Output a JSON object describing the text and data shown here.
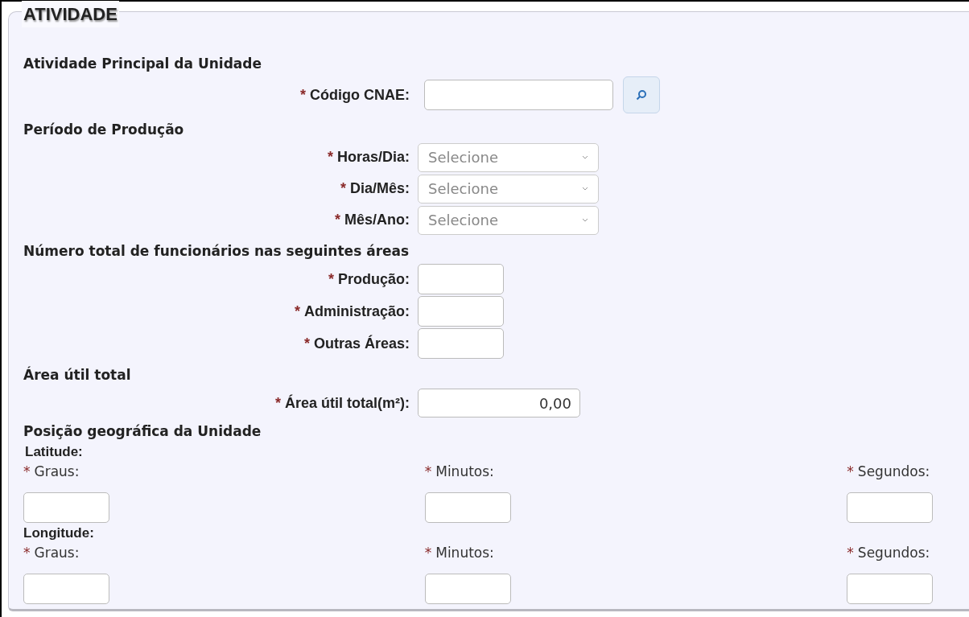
{
  "legend": "ATIVIDADE",
  "sections": [
    {
      "heading": "Atividade Principal da Unidade",
      "fields": [
        {
          "kind": "search",
          "label": "Código CNAE:",
          "required_mark": "*"
        }
      ]
    },
    {
      "heading": "Período de Produção",
      "fields": [
        {
          "kind": "select",
          "label": "Horas/Dia:",
          "required_mark": "*",
          "placeholder": "Selecione"
        },
        {
          "kind": "select",
          "label": "Dia/Mês:",
          "required_mark": "*",
          "placeholder": "Selecione"
        },
        {
          "kind": "select",
          "label": "Mês/Ano:",
          "required_mark": "*",
          "placeholder": "Selecione"
        }
      ]
    },
    {
      "heading": "Número total de funcionários nas seguintes áreas",
      "fields": [
        {
          "kind": "small",
          "label": "Produção:",
          "required_mark": "*"
        },
        {
          "kind": "small",
          "label": "Administração:",
          "required_mark": "*"
        },
        {
          "kind": "small",
          "label": "Outras Áreas:",
          "required_mark": "*"
        }
      ]
    },
    {
      "heading": "Área útil total",
      "fields": [
        {
          "kind": "number",
          "label": "Área útil total(m²):",
          "required_mark": "*",
          "value": "0,00"
        }
      ]
    }
  ],
  "geo": {
    "heading": "Posição geográfica da Unidade",
    "groups": [
      {
        "label": "Latitude:",
        "fields": [
          {
            "label": "Graus:",
            "required_mark": "*"
          },
          {
            "label": "Minutos:",
            "required_mark": "*"
          },
          {
            "label": "Segundos:",
            "required_mark": "*"
          }
        ]
      },
      {
        "label": "Longitude:",
        "fields": [
          {
            "label": "Graus:",
            "required_mark": "*"
          },
          {
            "label": "Minutos:",
            "required_mark": "*"
          },
          {
            "label": "Segundos:",
            "required_mark": "*"
          }
        ]
      }
    ]
  }
}
